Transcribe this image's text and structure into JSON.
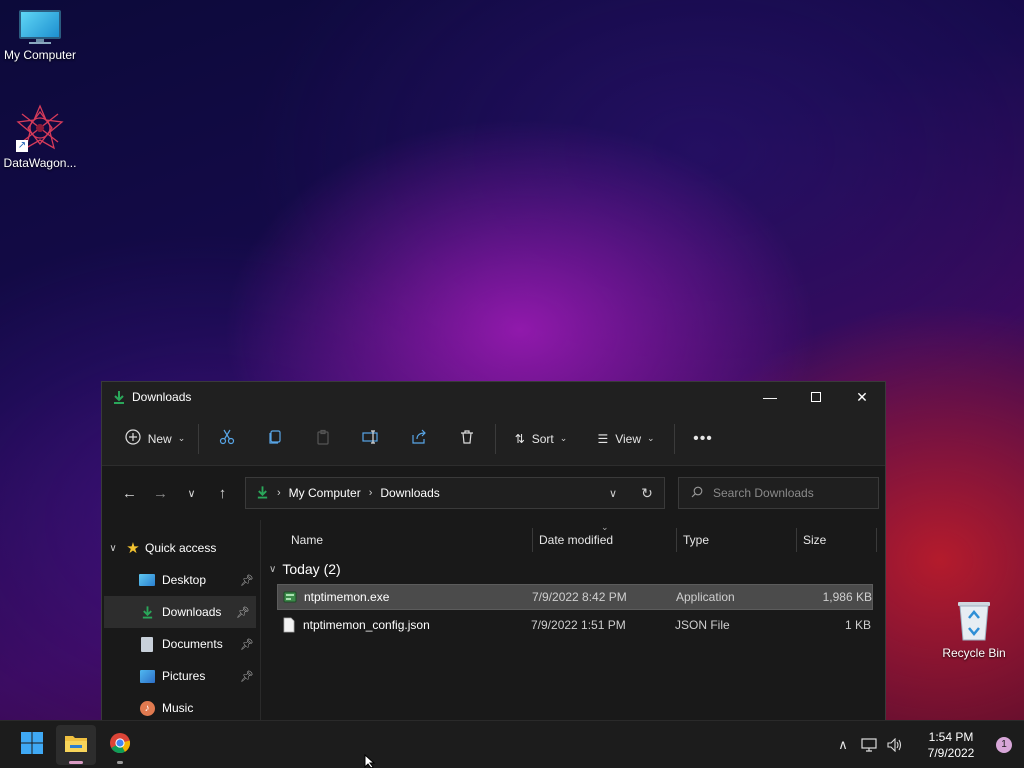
{
  "desktop": {
    "icons": [
      {
        "label": "My Computer"
      },
      {
        "label": "DataWagon..."
      },
      {
        "label": "Recycle Bin"
      }
    ]
  },
  "window": {
    "title": "Downloads",
    "toolbar": {
      "new_label": "New",
      "sort_label": "Sort",
      "view_label": "View"
    },
    "address": {
      "crumbs": [
        "My Computer",
        "Downloads"
      ]
    },
    "search": {
      "placeholder": "Search Downloads"
    },
    "sidebar": {
      "items": [
        {
          "label": "Quick access"
        },
        {
          "label": "Desktop"
        },
        {
          "label": "Downloads"
        },
        {
          "label": "Documents"
        },
        {
          "label": "Pictures"
        },
        {
          "label": "Music"
        }
      ]
    },
    "columns": {
      "name": "Name",
      "date": "Date modified",
      "type": "Type",
      "size": "Size"
    },
    "group": "Today (2)",
    "files": [
      {
        "name": "ntptimemon.exe",
        "date": "7/9/2022 8:42 PM",
        "type": "Application",
        "size": "1,986 KB"
      },
      {
        "name": "ntptimemon_config.json",
        "date": "7/9/2022 1:51 PM",
        "type": "JSON File",
        "size": "1 KB"
      }
    ]
  },
  "taskbar": {
    "time": "1:54 PM",
    "date": "7/9/2022",
    "notification_count": "1"
  },
  "colors": {
    "accent": "#2aa75a",
    "window_bg": "#202020",
    "selection": "#4b4b4b"
  }
}
